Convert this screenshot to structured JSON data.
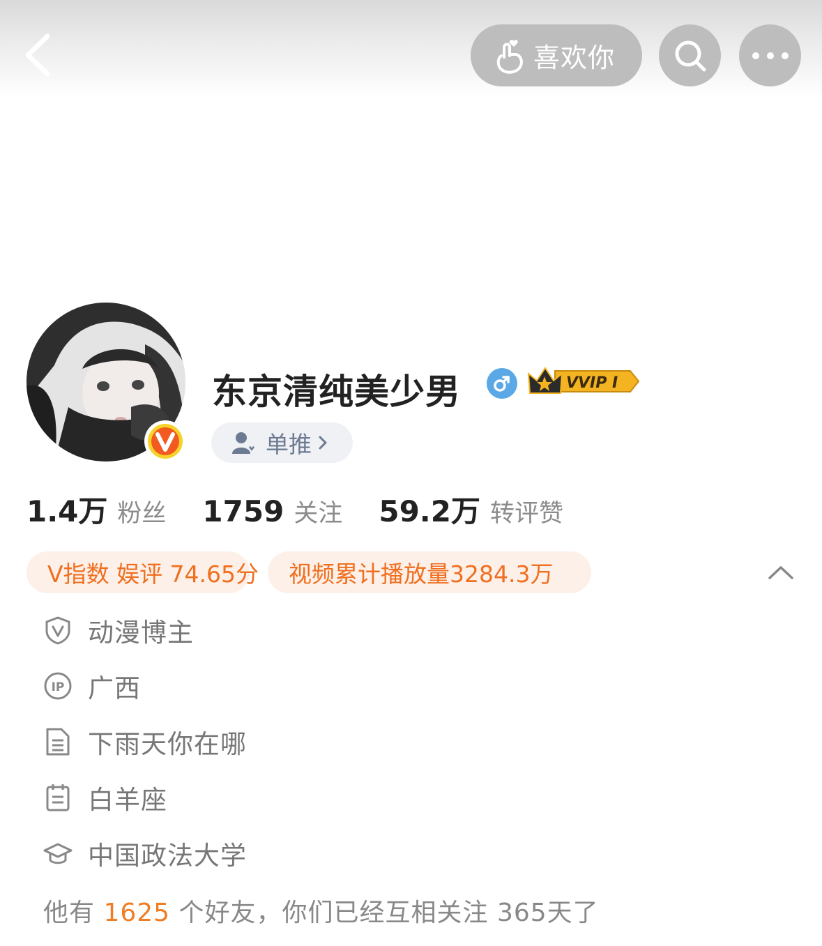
{
  "topbar": {
    "like_label": "喜欢你"
  },
  "profile": {
    "nickname": "东京清纯美少男",
    "vip_badge_text": "VVIP I",
    "dantui_label": "单推"
  },
  "stats": [
    {
      "number": "1.4万",
      "label": "粉丝"
    },
    {
      "number": "1759",
      "label": "关注"
    },
    {
      "number": "59.2万",
      "label": "转评赞"
    }
  ],
  "tags": [
    {
      "text": "V指数 娱评 74.65分"
    },
    {
      "text": "视频累计播放量3284.3万"
    }
  ],
  "info": {
    "verification": "动漫博主",
    "ip_location": "广西",
    "bio": "下雨天你在哪",
    "zodiac": "白羊座",
    "school": "中国政法大学"
  },
  "friends": {
    "prefix": "他有 ",
    "count": "1625",
    "suffix": " 个好友，你们已经互相关注 365天了"
  },
  "colors": {
    "accent_orange": "#f06f1f",
    "verified_orange": "#f25a1f",
    "gender_blue": "#5aa9e6",
    "vip_gold": "#f4b321"
  }
}
